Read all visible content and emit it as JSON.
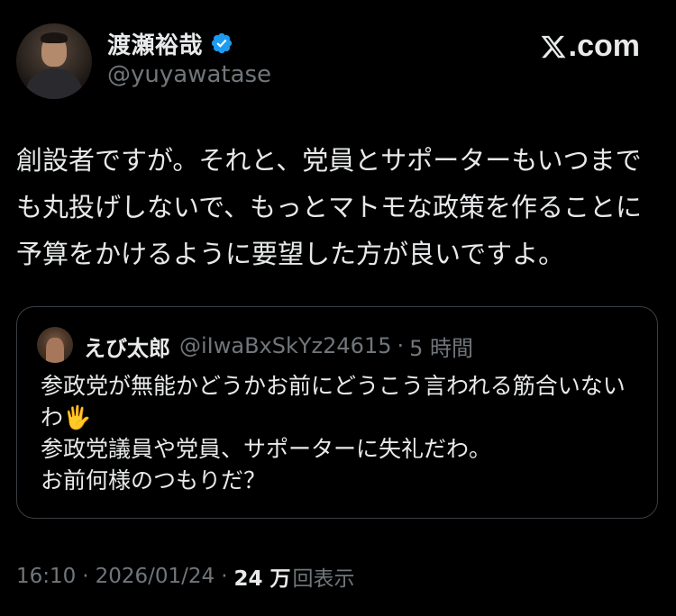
{
  "colors": {
    "background": "#000000",
    "text_primary": "#e7e9ea",
    "text_secondary": "#71767b",
    "verified_badge": "#1d9bf0",
    "quote_border": "#3a3f44"
  },
  "author": {
    "display_name": "渡瀬裕哉",
    "handle": "@yuyawatase",
    "verified": true,
    "verified_icon": "verified-badge-icon"
  },
  "brand": {
    "logo_icon": "x-logo-icon",
    "domain_suffix": ".com"
  },
  "tweet": {
    "text": "創設者ですが。それと、党員とサポーターもいつまでも丸投げしないで、もっとマトモな政策を作ることに予算をかけるように要望した方が良いですよ。"
  },
  "quoted_tweet": {
    "display_name": "えび太郎",
    "handle": "@iIwaBxSkYz24615",
    "separator": "·",
    "time": "5 時間",
    "lines": [
      "参政党が無能かどうかお前にどうこう言われる筋合いないわ🖐",
      "参政党議員や党員、サポーターに失礼だわ。",
      "お前何様のつもりだ？"
    ]
  },
  "meta": {
    "time": "16:10",
    "separator": "·",
    "date": "2026/01/24",
    "views_count": "24 万",
    "views_label": "回表示"
  }
}
